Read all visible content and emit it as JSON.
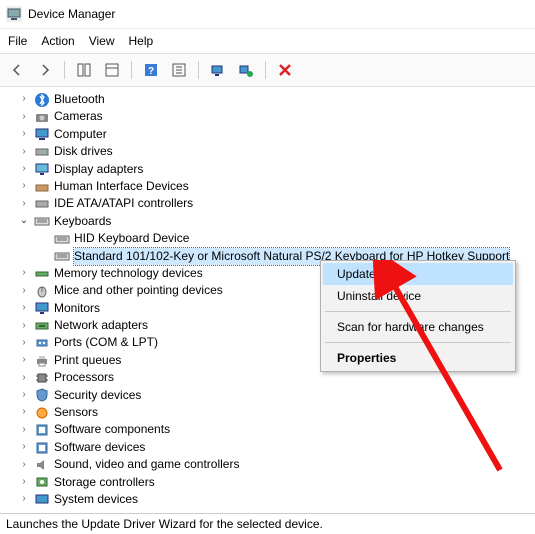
{
  "window": {
    "title": "Device Manager"
  },
  "menu": {
    "file": "File",
    "action": "Action",
    "view": "View",
    "help": "Help"
  },
  "tree": {
    "bluetooth": "Bluetooth",
    "cameras": "Cameras",
    "computer": "Computer",
    "disk": "Disk drives",
    "display": "Display adapters",
    "hid": "Human Interface Devices",
    "ide": "IDE ATA/ATAPI controllers",
    "keyboards": "Keyboards",
    "kb_hid": "HID Keyboard Device",
    "kb_std": "Standard 101/102-Key or Microsoft Natural PS/2 Keyboard for HP Hotkey Support",
    "memory": "Memory technology devices",
    "mice": "Mice and other pointing devices",
    "monitors": "Monitors",
    "network": "Network adapters",
    "ports": "Ports (COM & LPT)",
    "printq": "Print queues",
    "processors": "Processors",
    "security": "Security devices",
    "sensors": "Sensors",
    "swcomp": "Software components",
    "swdev": "Software devices",
    "sound": "Sound, video and game controllers",
    "storage": "Storage controllers",
    "system": "System devices"
  },
  "context": {
    "update": "Update driver",
    "uninstall": "Uninstall device",
    "scan": "Scan for hardware changes",
    "properties": "Properties"
  },
  "status": {
    "text": "Launches the Update Driver Wizard for the selected device."
  }
}
